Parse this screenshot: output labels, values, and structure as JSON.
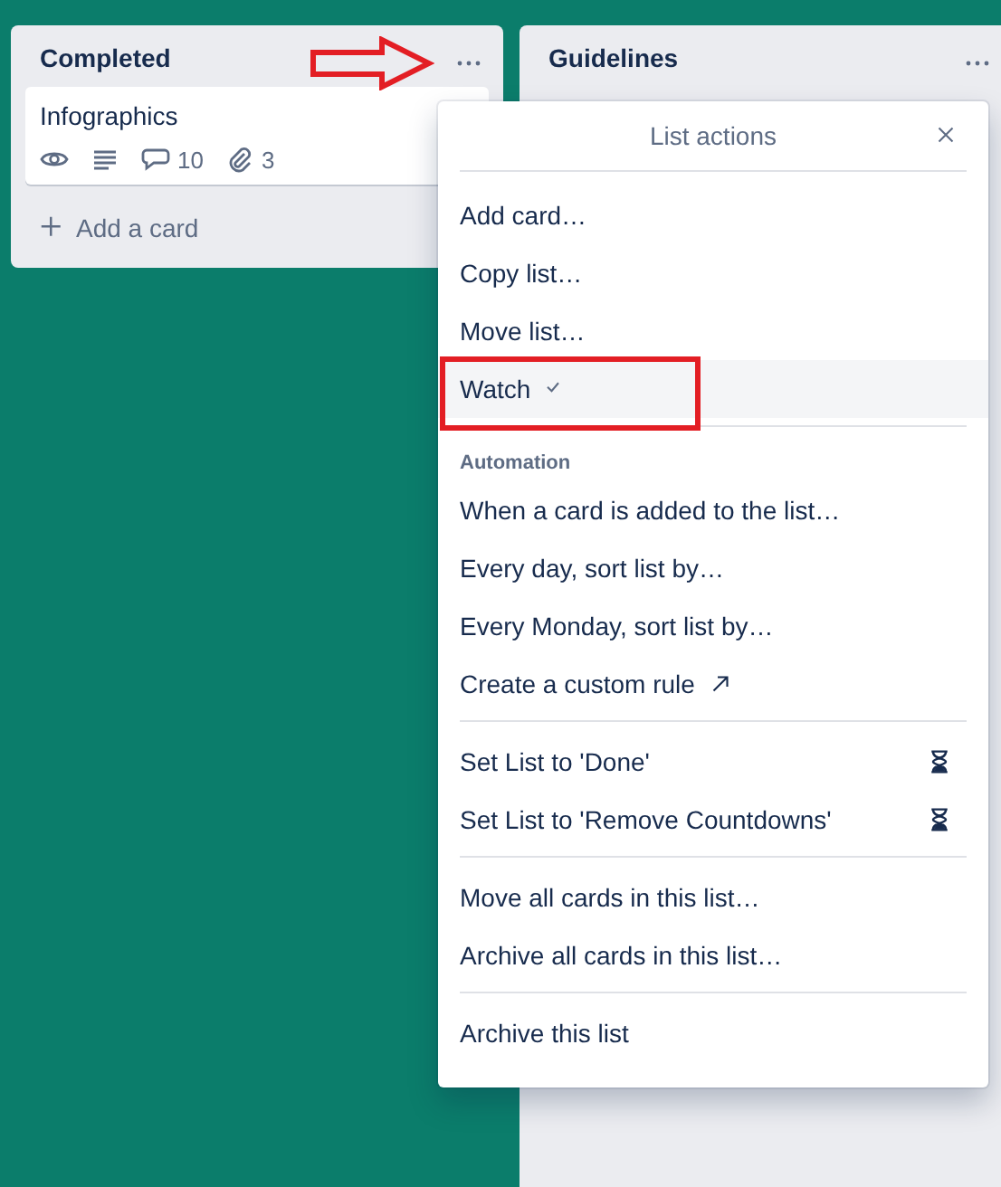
{
  "lists": [
    {
      "title": "Completed",
      "cards": [
        {
          "title": "Infographics",
          "badges": [
            {
              "kind": "watch"
            },
            {
              "kind": "description"
            },
            {
              "kind": "comments",
              "text": "10"
            },
            {
              "kind": "attachments",
              "text": "3"
            }
          ]
        }
      ],
      "add_card": "Add a card"
    },
    {
      "title": "Guidelines"
    }
  ],
  "menu": {
    "title": "List actions",
    "sections": [
      {
        "items": [
          {
            "label": "Add card…",
            "kind": "plain",
            "checked": false,
            "highlighted": false
          },
          {
            "label": "Copy list…",
            "kind": "plain",
            "checked": false,
            "highlighted": false
          },
          {
            "label": "Move list…",
            "kind": "plain",
            "checked": false,
            "highlighted": false
          },
          {
            "label": "Watch",
            "kind": "plain",
            "checked": true,
            "highlighted": true
          }
        ]
      },
      {
        "heading": "Automation",
        "items": [
          {
            "label": "When a card is added to the list…",
            "kind": "plain",
            "checked": false,
            "highlighted": false
          },
          {
            "label": "Every day, sort list by…",
            "kind": "plain",
            "checked": false,
            "highlighted": false
          },
          {
            "label": "Every Monday, sort list by…",
            "kind": "plain",
            "checked": false,
            "highlighted": false
          },
          {
            "label": "Create a custom rule",
            "kind": "external",
            "checked": false,
            "highlighted": false
          }
        ]
      },
      {
        "items": [
          {
            "label": "Set List to 'Done'",
            "kind": "hourglass",
            "checked": false,
            "highlighted": false
          },
          {
            "label": "Set List to 'Remove Countdowns'",
            "kind": "hourglass",
            "checked": false,
            "highlighted": false
          }
        ]
      },
      {
        "items": [
          {
            "label": "Move all cards in this list…",
            "kind": "plain",
            "checked": false,
            "highlighted": false
          },
          {
            "label": "Archive all cards in this list…",
            "kind": "plain",
            "checked": false,
            "highlighted": false
          }
        ]
      },
      {
        "items": [
          {
            "label": "Archive this list",
            "kind": "plain",
            "checked": false,
            "highlighted": false
          }
        ]
      }
    ]
  }
}
